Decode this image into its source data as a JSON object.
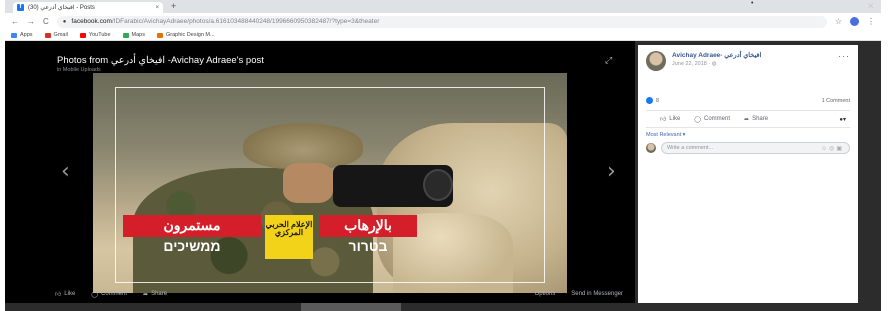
{
  "browser": {
    "tab_title": "(30) افيخاي أدرعي - Posts",
    "tab_close": "×",
    "new_tab": "+",
    "url_host": "facebook.com",
    "url_path": "/IDFarabic/AvichayAdraee/photos/a.616103488440248/1996660950382487/?type=3&theater",
    "bookmarks": [
      {
        "label": "Apps",
        "color": "#4285f4"
      },
      {
        "label": "Gmail",
        "color": "#d93025"
      },
      {
        "label": "YouTube",
        "color": "#ff0000"
      },
      {
        "label": "Maps",
        "color": "#34a853"
      },
      {
        "label": "Graphic Design M...",
        "color": "#e37400"
      }
    ]
  },
  "theater": {
    "title": "Photos from افيخاي أدرعي -Avichay Adraee's post",
    "subtitle": "in Mobile Uploads",
    "image_text": {
      "line1_right": "بالإرهاب",
      "line2_right": "בטרור",
      "center": "الإعلام الحربي المركزي",
      "line1_left": "مستمرون",
      "line2_left": "ממשיכים"
    },
    "actions": {
      "like": "Like",
      "comment": "Comment",
      "share": "Share",
      "options": "Options",
      "messenger": "Send in Messenger"
    }
  },
  "side": {
    "author": "Avichay Adraee- افيخاي أدرعي",
    "date": "June 22, 2018 · ",
    "reactions_count": "8",
    "comments_count": "1 Comment",
    "actions": {
      "like": "Like",
      "comment": "Comment",
      "share": "Share"
    },
    "sort_label": "Most Relevant ▾",
    "comment_placeholder": "Write a comment..."
  }
}
